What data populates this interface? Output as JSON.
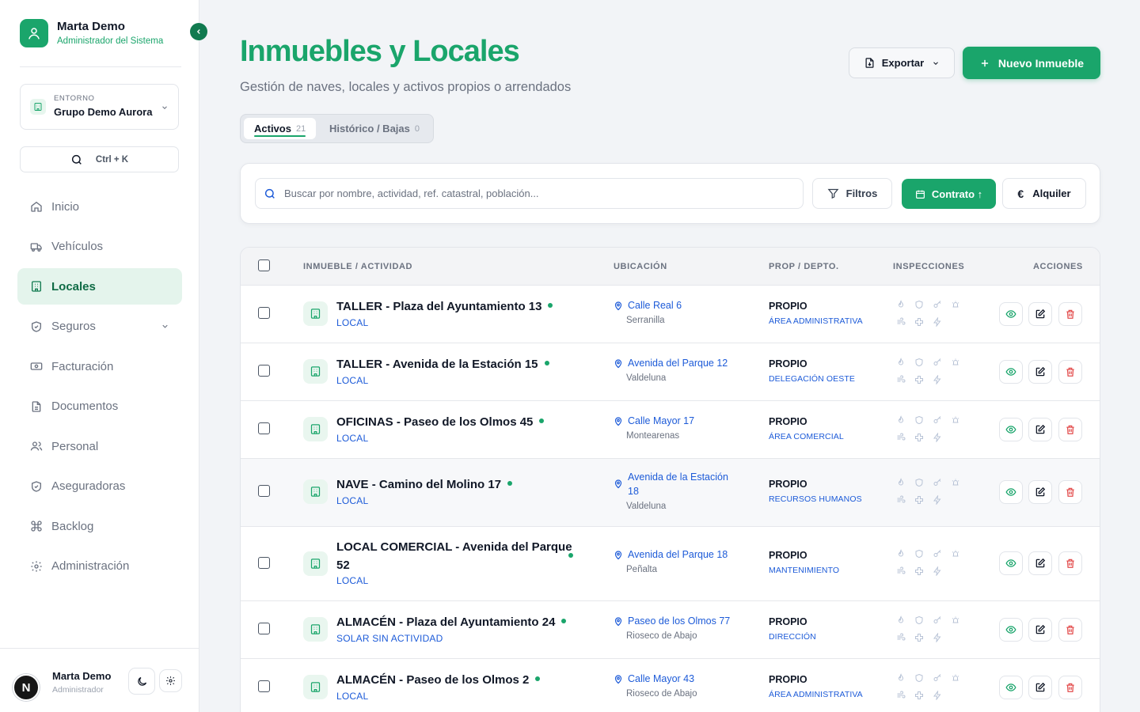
{
  "sidebar": {
    "profile": {
      "name": "Marta Demo",
      "role": "Administrador del Sistema"
    },
    "environment": {
      "label": "ENTORNO",
      "value": "Grupo Demo Aurora"
    },
    "command": {
      "shortcut": "Ctrl + K"
    },
    "nav": [
      {
        "label": "Inicio",
        "icon": "home-icon"
      },
      {
        "label": "Vehículos",
        "icon": "truck-icon"
      },
      {
        "label": "Locales",
        "icon": "building-icon",
        "active": true
      },
      {
        "label": "Seguros",
        "icon": "shield-icon",
        "expandable": true
      },
      {
        "label": "Facturación",
        "icon": "banknote-icon"
      },
      {
        "label": "Documentos",
        "icon": "document-icon"
      },
      {
        "label": "Personal",
        "icon": "users-icon"
      },
      {
        "label": "Aseguradoras",
        "icon": "shield-check-icon"
      },
      {
        "label": "Backlog",
        "icon": "command-icon"
      },
      {
        "label": "Administración",
        "icon": "gear-icon"
      }
    ],
    "user": {
      "initial": "N",
      "name": "Marta Demo",
      "role": "Administrador"
    }
  },
  "header": {
    "title": "Inmuebles y Locales",
    "subtitle": "Gestión de naves, locales y activos propios o arrendados",
    "export_label": "Exportar",
    "new_label": "Nuevo Inmueble"
  },
  "tabs": [
    {
      "label": "Activos",
      "count": "21"
    },
    {
      "label": "Histórico / Bajas",
      "count": "0"
    }
  ],
  "search": {
    "placeholder": "Buscar por nombre, actividad, ref. catastral, población...",
    "filters_label": "Filtros",
    "contrato_label": "Contrato ↑",
    "alquiler_label": "Alquiler"
  },
  "table": {
    "headers": {
      "inmueble": "INMUEBLE / ACTIVIDAD",
      "ubicacion": "UBICACIÓN",
      "prop": "PROP / DEPTO.",
      "inspecciones": "INSPECCIONES",
      "acciones": "ACCIONES"
    },
    "rows": [
      {
        "name": "TALLER - Plaza del Ayuntamiento 13",
        "type": "LOCAL",
        "street": "Calle Real 6",
        "town": "Serranilla",
        "prop": "PROPIO",
        "dept": "ÁREA ADMINISTRATIVA"
      },
      {
        "name": "TALLER - Avenida de la Estación 15",
        "type": "LOCAL",
        "street": "Avenida del Parque 12",
        "town": "Valdeluna",
        "prop": "PROPIO",
        "dept": "DELEGACIÓN OESTE"
      },
      {
        "name": "OFICINAS - Paseo de los Olmos 45",
        "type": "LOCAL",
        "street": "Calle Mayor 17",
        "town": "Montearenas",
        "prop": "PROPIO",
        "dept": "ÁREA COMERCIAL"
      },
      {
        "name": "NAVE - Camino del Molino 17",
        "type": "LOCAL",
        "street_line1": "Avenida de la Estación",
        "street_line2": "18",
        "town": "Valdeluna",
        "prop": "PROPIO",
        "dept": "RECURSOS HUMANOS"
      },
      {
        "name_line1": "LOCAL COMERCIAL - Avenida del Parque",
        "name_line2": "52",
        "type": "LOCAL",
        "street": "Avenida del Parque 18",
        "town": "Peñalta",
        "prop": "PROPIO",
        "dept": "MANTENIMIENTO"
      },
      {
        "name": "ALMACÉN - Plaza del Ayuntamiento 24",
        "type": "SOLAR SIN ACTIVIDAD",
        "street": "Paseo de los Olmos 77",
        "town": "Rioseco de Abajo",
        "prop": "PROPIO",
        "dept": "DIRECCIÓN"
      },
      {
        "name": "ALMACÉN - Paseo de los Olmos 2",
        "type": "LOCAL",
        "street": "Calle Mayor 43",
        "town": "Rioseco de Abajo",
        "prop": "PROPIO",
        "dept": "ÁREA ADMINISTRATIVA"
      }
    ]
  },
  "colors": {
    "brand": "#1aa56b",
    "link": "#1d5bd8",
    "danger": "#e34d4d"
  }
}
